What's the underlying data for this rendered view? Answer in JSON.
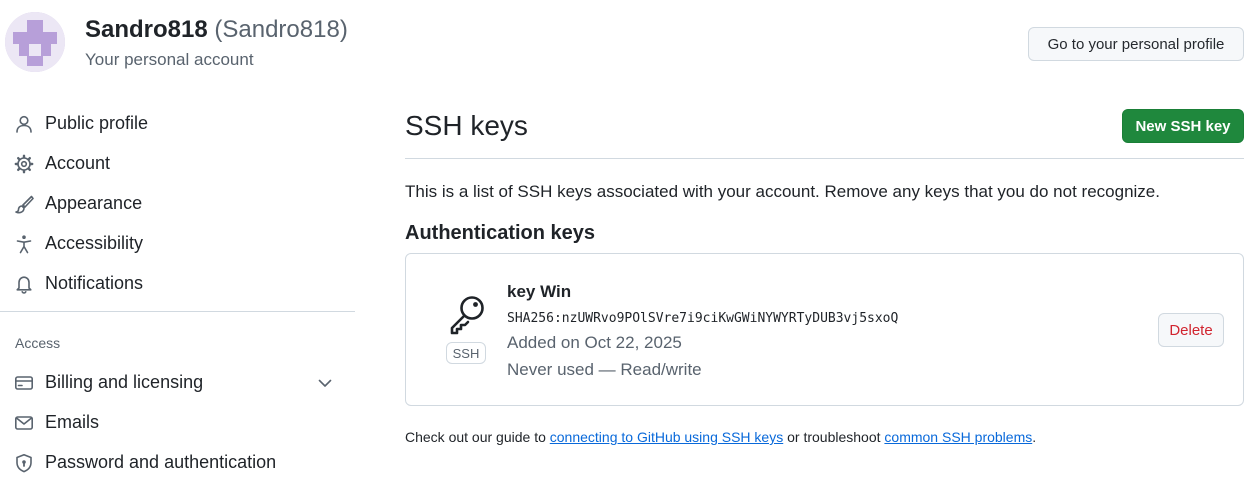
{
  "header": {
    "display_name": "Sandro818",
    "login": "(Sandro818)",
    "subtitle": "Your personal account",
    "profile_button": "Go to your personal profile"
  },
  "sidebar": {
    "items": [
      {
        "label": "Public profile",
        "icon": "person-icon"
      },
      {
        "label": "Account",
        "icon": "gear-icon"
      },
      {
        "label": "Appearance",
        "icon": "paintbrush-icon"
      },
      {
        "label": "Accessibility",
        "icon": "accessibility-icon"
      },
      {
        "label": "Notifications",
        "icon": "bell-icon"
      }
    ],
    "access_section": {
      "label": "Access",
      "items": [
        {
          "label": "Billing and licensing",
          "icon": "credit-card-icon",
          "expandable": true
        },
        {
          "label": "Emails",
          "icon": "mail-icon"
        },
        {
          "label": "Password and authentication",
          "icon": "shield-lock-icon"
        }
      ]
    }
  },
  "main": {
    "title": "SSH keys",
    "new_key_button": "New SSH key",
    "intro": "This is a list of SSH keys associated with your account. Remove any keys that you do not recognize.",
    "section_heading": "Authentication keys",
    "keys": [
      {
        "title": "key Win",
        "fingerprint": "SHA256:nzUWRvo9POlSVre7i9ciKwGWiNYWYRTyDUB3vj5sxoQ",
        "added": "Added on Oct 22, 2025",
        "usage": "Never used — Read/write",
        "badge": "SSH",
        "delete_label": "Delete",
        "icon": "key-icon"
      }
    ],
    "footer": {
      "prefix": "Check out our guide to ",
      "link1": "connecting to GitHub using SSH keys",
      "middle": " or troubleshoot ",
      "link2": "common SSH problems",
      "suffix": "."
    }
  },
  "colors": {
    "primary_button": "#1f883d",
    "danger_text": "#d1242f",
    "link": "#0969da",
    "avatar": "#b79fd9"
  }
}
